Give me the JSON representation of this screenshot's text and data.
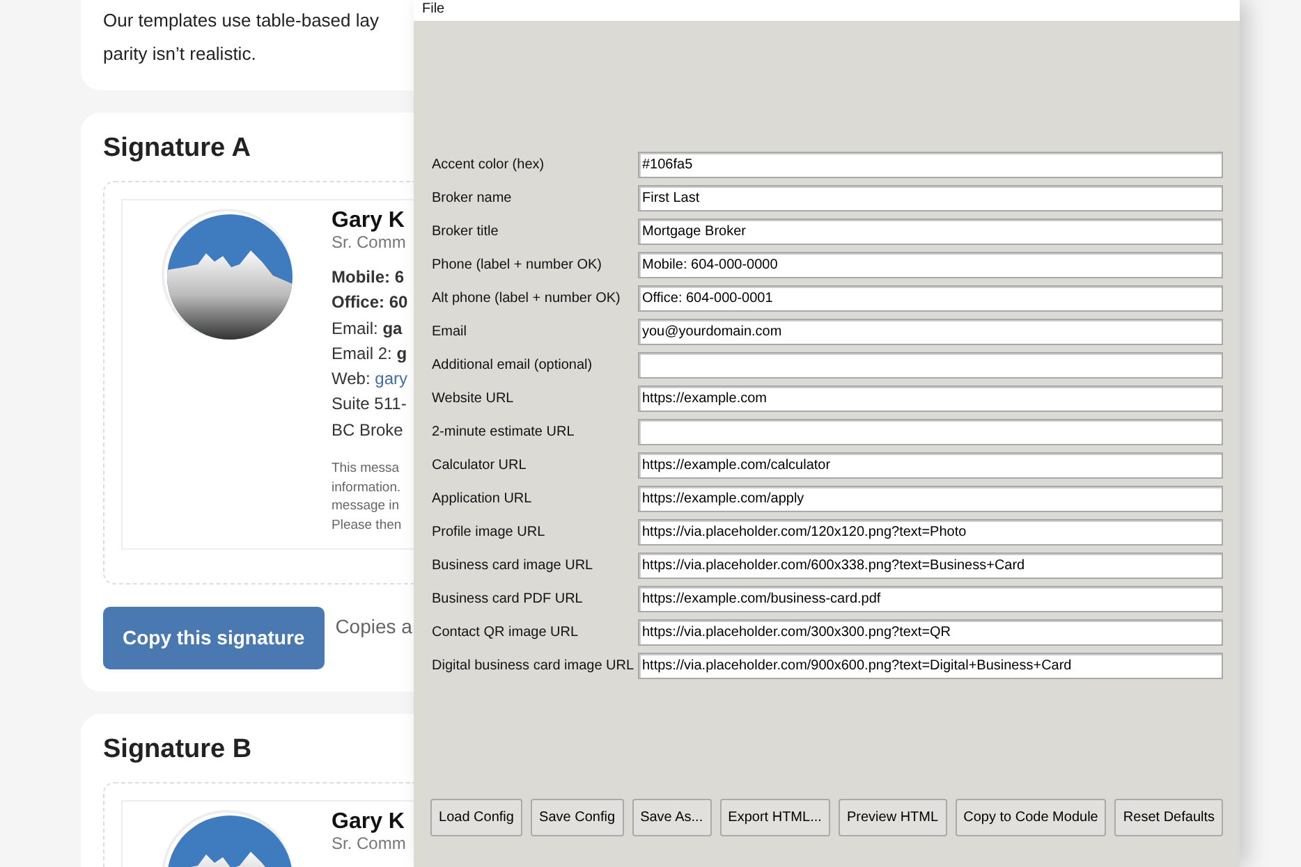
{
  "page": {
    "intro": [
      "Our templates use table-based lay",
      "parity isn’t realistic."
    ],
    "signatures": [
      {
        "title": "Signature A",
        "name": "Gary K",
        "role": "Sr. Comm",
        "lines": [
          {
            "kind": "bold",
            "text": "Mobile: 6"
          },
          {
            "kind": "bold",
            "text": "Office: 60"
          },
          {
            "kind": "plain",
            "text": "Email: **ga**"
          },
          {
            "kind": "plain",
            "text": "Email 2: **g**"
          },
          {
            "kind": "link",
            "text": "Web:",
            "link": "gary"
          },
          {
            "kind": "plain",
            "text": "Suite 511-"
          },
          {
            "kind": "plain",
            "text": "BC Broke"
          }
        ],
        "disclaimer": [
          "This messa",
          "information.",
          "message in",
          "Please then"
        ],
        "copy_button": "Copy this signature",
        "note": "Copies a"
      },
      {
        "title": "Signature B",
        "name": "Gary K",
        "role": "Sr. Comm"
      }
    ]
  },
  "app": {
    "menu": [
      "File"
    ],
    "fields": [
      {
        "label": "Accent color (hex)",
        "value": "#106fa5"
      },
      {
        "label": "Broker name",
        "value": "First Last"
      },
      {
        "label": "Broker title",
        "value": "Mortgage Broker"
      },
      {
        "label": "Phone (label + number OK)",
        "value": "Mobile: 604-000-0000"
      },
      {
        "label": "Alt phone (label + number OK)",
        "value": "Office: 604-000-0001"
      },
      {
        "label": "Email",
        "value": "you@yourdomain.com"
      },
      {
        "label": "Additional email (optional)"
      },
      {
        "label": "Website URL",
        "value": "https://example.com"
      },
      {
        "label": "2-minute estimate URL"
      },
      {
        "label": "Calculator URL",
        "value": "https://example.com/calculator"
      },
      {
        "label": "Application URL",
        "value": "https://example.com/apply"
      },
      {
        "label": "Profile image URL",
        "value": "https://via.placeholder.com/120x120.png?text=Photo"
      },
      {
        "label": "Business card image URL",
        "value": "https://via.placeholder.com/600x338.png?text=Business+Card"
      },
      {
        "label": "Business card PDF URL",
        "value": "https://example.com/business-card.pdf"
      },
      {
        "label": "Contact QR image URL",
        "value": "https://via.placeholder.com/300x300.png?text=QR"
      },
      {
        "label": "Digital business card image URL",
        "value": "https://via.placeholder.com/900x600.png?text=Digital+Business+Card"
      }
    ],
    "buttons": [
      "Load Config",
      "Save Config",
      "Save As...",
      "Export HTML...",
      "Preview HTML",
      "Copy to Code Module",
      "Reset Defaults"
    ]
  }
}
